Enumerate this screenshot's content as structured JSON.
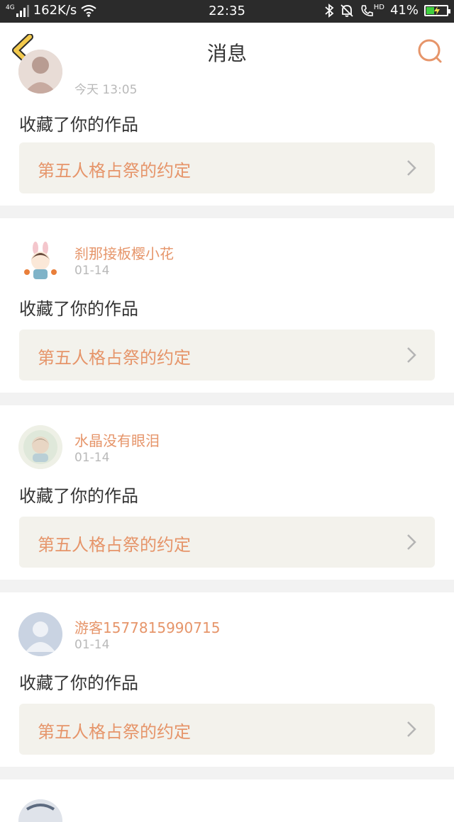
{
  "status_bar": {
    "signal": "4G",
    "speed": "162K/s",
    "time": "22:35",
    "hd": "HD",
    "battery": "41%",
    "battery_level": 0.41,
    "icons": [
      "signal-icon",
      "wifi-icon",
      "bluetooth-icon",
      "mute-icon",
      "call-hd-icon",
      "battery-icon"
    ]
  },
  "header": {
    "title": "消息",
    "back_icon": "chevron-left-icon",
    "search_icon": "search-icon"
  },
  "colors": {
    "accent": "#e6956a",
    "back_arrow": "#f2c94c",
    "text": "#333333",
    "muted": "#b9b9b9",
    "card_box": "#f3f2ec"
  },
  "messages": [
    {
      "user": "",
      "date": "今天 13:05",
      "action": "收藏了你的作品",
      "work": "第五人格占祭的约定"
    },
    {
      "user": "刹那接板樱小花",
      "date": "01-14",
      "action": "收藏了你的作品",
      "work": "第五人格占祭的约定"
    },
    {
      "user": "水晶没有眼泪",
      "date": "01-14",
      "action": "收藏了你的作品",
      "work": "第五人格占祭的约定"
    },
    {
      "user": "游客1577815990715",
      "date": "01-14",
      "action": "收藏了你的作品",
      "work": "第五人格占祭的约定"
    }
  ]
}
